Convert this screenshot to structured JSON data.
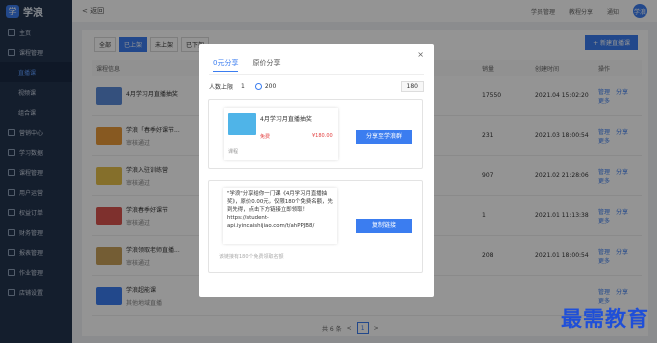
{
  "app": {
    "logo_mark": "学",
    "title": "学浪"
  },
  "topbar": {
    "back": "< 返回",
    "items": [
      "学员管理",
      "教程分享",
      "通知"
    ],
    "avatar": "学浪"
  },
  "sidebar": {
    "items": [
      {
        "label": "主页"
      },
      {
        "label": "课程管理",
        "active": false
      },
      {
        "label": "直播课",
        "sub": true,
        "active": true
      },
      {
        "label": "视频课",
        "sub": true
      },
      {
        "label": "组合课",
        "sub": true
      },
      {
        "label": "营销中心"
      },
      {
        "label": "学习数据"
      },
      {
        "label": "课程管理"
      },
      {
        "label": "用户运营"
      },
      {
        "label": "权益订单"
      },
      {
        "label": "财务管理"
      },
      {
        "label": "报表管理"
      },
      {
        "label": "作业管理"
      },
      {
        "label": "店铺设置"
      }
    ]
  },
  "filters": [
    "全部",
    "已上架",
    "未上架",
    "已下架"
  ],
  "new_button": "+ 新建直播课",
  "table": {
    "headers": [
      "课程信息",
      "",
      "销量",
      "创建时间",
      "操作"
    ],
    "rows": [
      {
        "title": "4月学习月直播抽奖",
        "sub": "",
        "sales": "17550",
        "date": "2021.04 15:02:20",
        "color": "#5a8ad8"
      },
      {
        "title": "学浪「春季好课节...",
        "sub": "审核通过",
        "sales": "231",
        "date": "2021.03 18:00:54",
        "color": "#e89a3a"
      },
      {
        "title": "学浪入驻训练营",
        "sub": "审核通过",
        "sales": "907",
        "date": "2021.02 21:28:06",
        "color": "#e5c04a"
      },
      {
        "title": "学浪春季好课节",
        "sub": "审核通过",
        "sales": "1",
        "date": "2021.01 11:13:38",
        "color": "#d9534f"
      },
      {
        "title": "学浪领取老师直播...",
        "sub": "审核通过",
        "sales": "208",
        "date": "2021.01 18:00:54",
        "color": "#c9a15a"
      },
      {
        "title": "学浪超能课",
        "sub": "其他地域直播",
        "sales": "",
        "date": "",
        "color": "#3b7df0"
      }
    ],
    "ops": [
      "管理",
      "分享",
      "更多"
    ]
  },
  "pager": {
    "total": "共 6 条",
    "prev": "<",
    "page": "1",
    "next": ">"
  },
  "modal": {
    "close": "×",
    "tabs": [
      "0元分享",
      "原价分享"
    ],
    "limit_label": "人数上限",
    "limit_opt_a": "1",
    "limit_opt_b": "200",
    "limit_value": "180",
    "card": {
      "title": "4月学习月直播抽奖",
      "price": "免费",
      "orig": "¥180.00",
      "foot": "课程"
    },
    "share_button": "分享至学浪群",
    "share_text": "\"学浪\"分享给你一门课《4月学习月直播抽奖》，原价0.00元，仅限180个免费名额，先到先得，点击下方链接立即领取！https://student-api.iyincaishijiao.com/t/ahPPJB8/",
    "copy_button": "复制链接",
    "note": "该链接有180个免费领取名额"
  },
  "watermark": "最需教育",
  "colors": {
    "accent": "#3b7df0",
    "sidebar": "#23344f",
    "price": "#e34040"
  }
}
